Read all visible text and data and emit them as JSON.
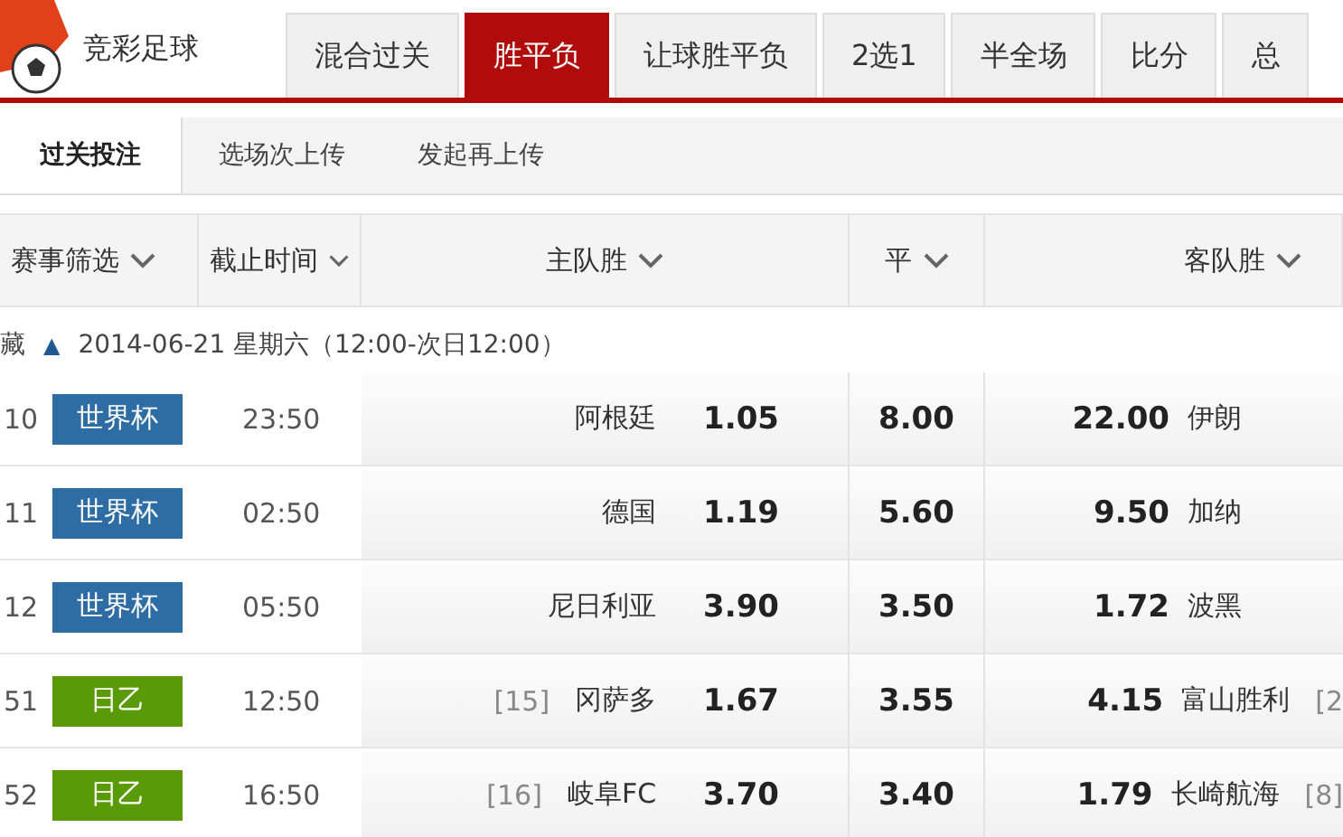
{
  "logo": {
    "title": "竞彩足球"
  },
  "tabs": [
    {
      "label": "混合过关",
      "selected": false
    },
    {
      "label": "胜平负",
      "selected": true
    },
    {
      "label": "让球胜平负",
      "selected": false
    },
    {
      "label": "2选1",
      "selected": false
    },
    {
      "label": "半全场",
      "selected": false
    },
    {
      "label": "比分",
      "selected": false
    },
    {
      "label": "总",
      "selected": false
    }
  ],
  "subtabs": [
    {
      "label": "过关投注",
      "selected": true
    },
    {
      "label": "选场次上传",
      "selected": false
    },
    {
      "label": "发起再上传",
      "selected": false
    }
  ],
  "columns": [
    "赛事筛选",
    "截止时间",
    "主队胜",
    "平",
    "客队胜"
  ],
  "date_row": {
    "toggle": "藏",
    "arrow": "▲",
    "text": "2014-06-21 星期六（12:00-次日12:00）"
  },
  "rows": [
    {
      "no": "10",
      "league": "世界杯",
      "color": "#2e6da4",
      "time": "23:50",
      "home_rank": "",
      "home": "阿根廷",
      "win": "1.05",
      "draw": "8.00",
      "lose": "22.00",
      "away": "伊朗",
      "away_rank": ""
    },
    {
      "no": "11",
      "league": "世界杯",
      "color": "#2e6da4",
      "time": "02:50",
      "home_rank": "",
      "home": "德国",
      "win": "1.19",
      "draw": "5.60",
      "lose": "9.50",
      "away": "加纳",
      "away_rank": ""
    },
    {
      "no": "12",
      "league": "世界杯",
      "color": "#2e6da4",
      "time": "05:50",
      "home_rank": "",
      "home": "尼日利亚",
      "win": "3.90",
      "draw": "3.50",
      "lose": "1.72",
      "away": "波黑",
      "away_rank": ""
    },
    {
      "no": "51",
      "league": "日乙",
      "color": "#5a9a08",
      "time": "12:50",
      "home_rank": "[15]",
      "home": "冈萨多",
      "win": "1.67",
      "draw": "3.55",
      "lose": "4.15",
      "away": "富山胜利",
      "away_rank": "[2"
    },
    {
      "no": "52",
      "league": "日乙",
      "color": "#5a9a08",
      "time": "16:50",
      "home_rank": "[16]",
      "home": "岐阜FC",
      "win": "3.70",
      "draw": "3.40",
      "lose": "1.79",
      "away": "长崎航海",
      "away_rank": "[8]"
    }
  ]
}
